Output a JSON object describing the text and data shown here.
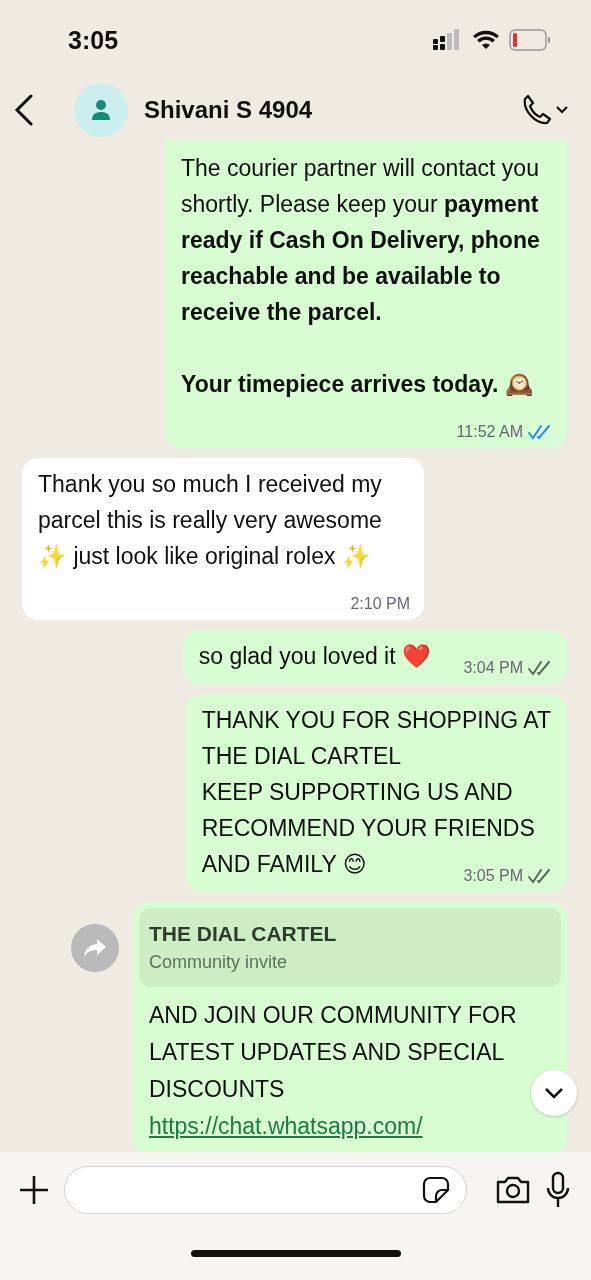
{
  "status_bar": {
    "time": "3:05"
  },
  "header": {
    "contact_name": "Shivani S 4904"
  },
  "messages": [
    {
      "kind": "outgoing",
      "text": "The courier partner will contact you shortly. Please keep your **payment ready if Cash On Delivery, phone reachable and be available to receive the parcel.**\n\n**Your timepiece arrives today.** 🕰️",
      "time": "11:52 AM",
      "read": true
    },
    {
      "kind": "incoming",
      "text": "Thank you so much I received my parcel this is really very awesome ✨ just look like original rolex ✨",
      "time": "2:10 PM"
    },
    {
      "kind": "outgoing",
      "text": "so glad you loved it ❤️",
      "time": "3:04 PM",
      "read": false
    },
    {
      "kind": "outgoing",
      "text": "THANK YOU FOR SHOPPING AT\nTHE DIAL CARTEL\nKEEP SUPPORTING US AND\nRECOMMEND YOUR FRIENDS\nAND FAMILY 😊",
      "time": "3:05 PM",
      "read": false
    },
    {
      "kind": "invite",
      "card_title": "THE DIAL CARTEL",
      "card_subtitle": "Community invite",
      "text": "AND JOIN OUR COMMUNITY FOR LATEST UPDATES AND SPECIAL DISCOUNTS",
      "link": "https://chat.whatsapp.com/"
    }
  ]
}
